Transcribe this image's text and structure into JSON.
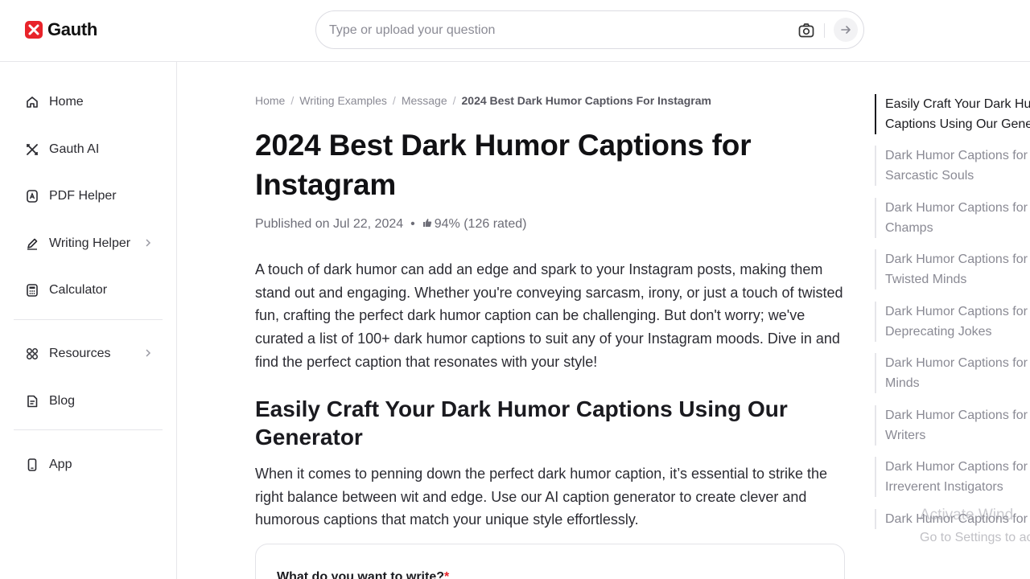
{
  "brand": {
    "name": "Gauth",
    "accent": "#e8232a"
  },
  "search": {
    "placeholder": "Type or upload your question"
  },
  "sidebar": {
    "items": [
      {
        "label": "Home",
        "icon": "home-icon"
      },
      {
        "label": "Gauth AI",
        "icon": "gauth-ai-icon"
      },
      {
        "label": "PDF Helper",
        "icon": "pdf-icon"
      },
      {
        "label": "Writing Helper",
        "icon": "pen-icon"
      },
      {
        "label": "Calculator",
        "icon": "calculator-icon"
      },
      {
        "label": "Resources",
        "icon": "grid-icon"
      },
      {
        "label": "Blog",
        "icon": "blog-icon"
      },
      {
        "label": "App",
        "icon": "phone-icon"
      }
    ]
  },
  "breadcrumb": [
    "Home",
    "Writing Examples",
    "Message",
    "2024 Best Dark Humor Captions For Instagram"
  ],
  "article": {
    "title_line1": "2024 Best Dark Humor Captions for",
    "title_line2": "Instagram",
    "published": "Published on Jul 22, 2024",
    "separator": "•",
    "rating": "94% (126 rated)",
    "intro": "A touch of dark humor can add an edge and spark to your Instagram posts, making them stand out and engaging. Whether you're conveying sarcasm, irony, or just a touch of twisted fun, crafting the perfect dark humor caption can be challenging. But don't worry; we've curated a list of 100+ dark humor captions to suit any of your Instagram moods. Dive in and find the perfect caption that resonates with your style!",
    "section_heading": "Easily Craft Your Dark Humor Captions Using Our Generator",
    "section_text": "When it comes to penning down the perfect dark humor caption, it’s essential to strike the right balance between wit and edge. Use our AI caption generator to create clever and humorous captions that match your unique style effortlessly.",
    "form_label": "What do you want to write?",
    "form_required": "*"
  },
  "toc": [
    {
      "line1": "Easily Craft Your Dark Hum",
      "line2": "Captions Using Our Genera"
    },
    {
      "line1": "Dark Humor Captions for",
      "line2": "Sarcastic Souls"
    },
    {
      "line1": "Dark Humor Captions for Ir",
      "line2": "Champs"
    },
    {
      "line1": "Dark Humor Captions for",
      "line2": "Twisted Minds"
    },
    {
      "line1": "Dark Humor Captions for S",
      "line2": "Deprecating Jokes"
    },
    {
      "line1": "Dark Humor Captions for M",
      "line2": "Minds"
    },
    {
      "line1": "Dark Humor Captions for W",
      "line2": "Writers"
    },
    {
      "line1": "Dark Humor Captions for",
      "line2": "Irreverent Instigators"
    },
    {
      "line1": "Dark Humor Captions for C",
      "line2": ""
    }
  ],
  "watermark": {
    "line1": "Activate Wind",
    "line2": "Go to Settings to ac"
  }
}
